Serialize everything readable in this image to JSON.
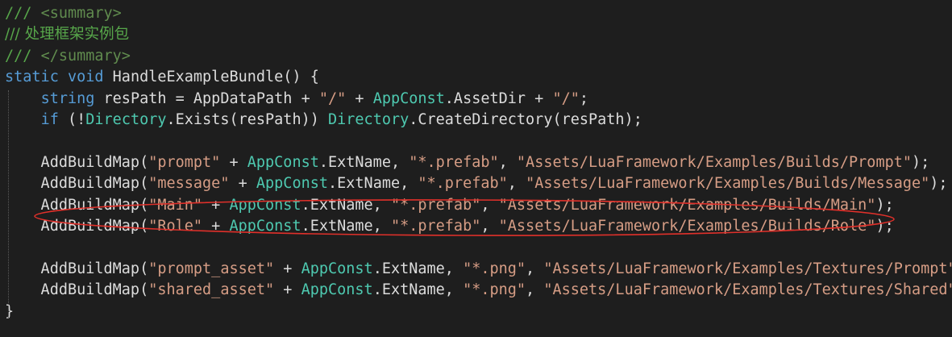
{
  "editor": {
    "background": "#1e1e1e",
    "colors": {
      "comment": "#57a64a",
      "keyword": "#569cd6",
      "type": "#4ec9b0",
      "string": "#d69d85",
      "plain": "#dcdcdc",
      "annotation": "#e0302a"
    },
    "lines": [
      {
        "tokens": [
          {
            "t": "/// ",
            "c": "comment"
          },
          {
            "t": "<summary>",
            "c": "xmldoc"
          }
        ]
      },
      {
        "tokens": [
          {
            "t": "/// 处理框架实例包",
            "c": "comment"
          }
        ]
      },
      {
        "tokens": [
          {
            "t": "/// ",
            "c": "comment"
          },
          {
            "t": "</summary>",
            "c": "xmldoc"
          }
        ]
      },
      {
        "tokens": [
          {
            "t": "static",
            "c": "keyword"
          },
          {
            "t": " ",
            "c": "plain"
          },
          {
            "t": "void",
            "c": "keyword"
          },
          {
            "t": " HandleExampleBundle() {",
            "c": "plain"
          }
        ]
      },
      {
        "tokens": [
          {
            "t": "    ",
            "c": "plain"
          },
          {
            "t": "string",
            "c": "keyword"
          },
          {
            "t": " resPath = AppDataPath + ",
            "c": "plain"
          },
          {
            "t": "\"/\"",
            "c": "string"
          },
          {
            "t": " + ",
            "c": "plain"
          },
          {
            "t": "AppConst",
            "c": "type"
          },
          {
            "t": ".AssetDir + ",
            "c": "plain"
          },
          {
            "t": "\"/\"",
            "c": "string"
          },
          {
            "t": ";",
            "c": "plain"
          }
        ]
      },
      {
        "tokens": [
          {
            "t": "    ",
            "c": "plain"
          },
          {
            "t": "if",
            "c": "keyword"
          },
          {
            "t": " (!",
            "c": "plain"
          },
          {
            "t": "Directory",
            "c": "type"
          },
          {
            "t": ".Exists(resPath)) ",
            "c": "plain"
          },
          {
            "t": "Directory",
            "c": "type"
          },
          {
            "t": ".CreateDirectory(resPath);",
            "c": "plain"
          }
        ]
      },
      {
        "tokens": [
          {
            "t": "",
            "c": "plain"
          }
        ]
      },
      {
        "tokens": [
          {
            "t": "    AddBuildMap(",
            "c": "plain"
          },
          {
            "t": "\"prompt\"",
            "c": "string"
          },
          {
            "t": " + ",
            "c": "plain"
          },
          {
            "t": "AppConst",
            "c": "type"
          },
          {
            "t": ".ExtName, ",
            "c": "plain"
          },
          {
            "t": "\"*.prefab\"",
            "c": "string"
          },
          {
            "t": ", ",
            "c": "plain"
          },
          {
            "t": "\"Assets/LuaFramework/Examples/Builds/Prompt\"",
            "c": "string"
          },
          {
            "t": ");",
            "c": "plain"
          }
        ]
      },
      {
        "tokens": [
          {
            "t": "    AddBuildMap(",
            "c": "plain"
          },
          {
            "t": "\"message\"",
            "c": "string"
          },
          {
            "t": " + ",
            "c": "plain"
          },
          {
            "t": "AppConst",
            "c": "type"
          },
          {
            "t": ".ExtName, ",
            "c": "plain"
          },
          {
            "t": "\"*.prefab\"",
            "c": "string"
          },
          {
            "t": ", ",
            "c": "plain"
          },
          {
            "t": "\"Assets/LuaFramework/Examples/Builds/Message\"",
            "c": "string"
          },
          {
            "t": ");",
            "c": "plain"
          }
        ]
      },
      {
        "tokens": [
          {
            "t": "    AddBuildMap(",
            "c": "plain"
          },
          {
            "t": "\"Main\"",
            "c": "string"
          },
          {
            "t": " + ",
            "c": "plain"
          },
          {
            "t": "AppConst",
            "c": "type"
          },
          {
            "t": ".ExtName, ",
            "c": "plain"
          },
          {
            "t": "\"*.prefab\"",
            "c": "string"
          },
          {
            "t": ", ",
            "c": "plain"
          },
          {
            "t": "\"Assets/LuaFramework/Examples/Builds/Main\"",
            "c": "string"
          },
          {
            "t": ");",
            "c": "plain"
          }
        ]
      },
      {
        "tokens": [
          {
            "t": "    AddBuildMap(",
            "c": "plain"
          },
          {
            "t": "\"Role\"",
            "c": "string"
          },
          {
            "t": " + ",
            "c": "plain"
          },
          {
            "t": "AppConst",
            "c": "type"
          },
          {
            "t": ".ExtName, ",
            "c": "plain"
          },
          {
            "t": "\"*.prefab\"",
            "c": "string"
          },
          {
            "t": ", ",
            "c": "plain"
          },
          {
            "t": "\"Assets/LuaFramework/Examples/Builds/Role\"",
            "c": "string"
          },
          {
            "t": ");",
            "c": "plain"
          }
        ]
      },
      {
        "tokens": [
          {
            "t": "",
            "c": "plain"
          }
        ]
      },
      {
        "tokens": [
          {
            "t": "    AddBuildMap(",
            "c": "plain"
          },
          {
            "t": "\"prompt_asset\"",
            "c": "string"
          },
          {
            "t": " + ",
            "c": "plain"
          },
          {
            "t": "AppConst",
            "c": "type"
          },
          {
            "t": ".ExtName, ",
            "c": "plain"
          },
          {
            "t": "\"*.png\"",
            "c": "string"
          },
          {
            "t": ", ",
            "c": "plain"
          },
          {
            "t": "\"Assets/LuaFramework/Examples/Textures/Prompt\"",
            "c": "string"
          },
          {
            "t": ");",
            "c": "plain"
          }
        ]
      },
      {
        "tokens": [
          {
            "t": "    AddBuildMap(",
            "c": "plain"
          },
          {
            "t": "\"shared_asset\"",
            "c": "string"
          },
          {
            "t": " + ",
            "c": "plain"
          },
          {
            "t": "AppConst",
            "c": "type"
          },
          {
            "t": ".ExtName, ",
            "c": "plain"
          },
          {
            "t": "\"*.png\"",
            "c": "string"
          },
          {
            "t": ", ",
            "c": "plain"
          },
          {
            "t": "\"Assets/LuaFramework/Examples/Textures/Shared\"",
            "c": "string"
          },
          {
            "t": ");",
            "c": "plain"
          }
        ]
      },
      {
        "tokens": [
          {
            "t": "}",
            "c": "plain"
          }
        ]
      }
    ]
  }
}
